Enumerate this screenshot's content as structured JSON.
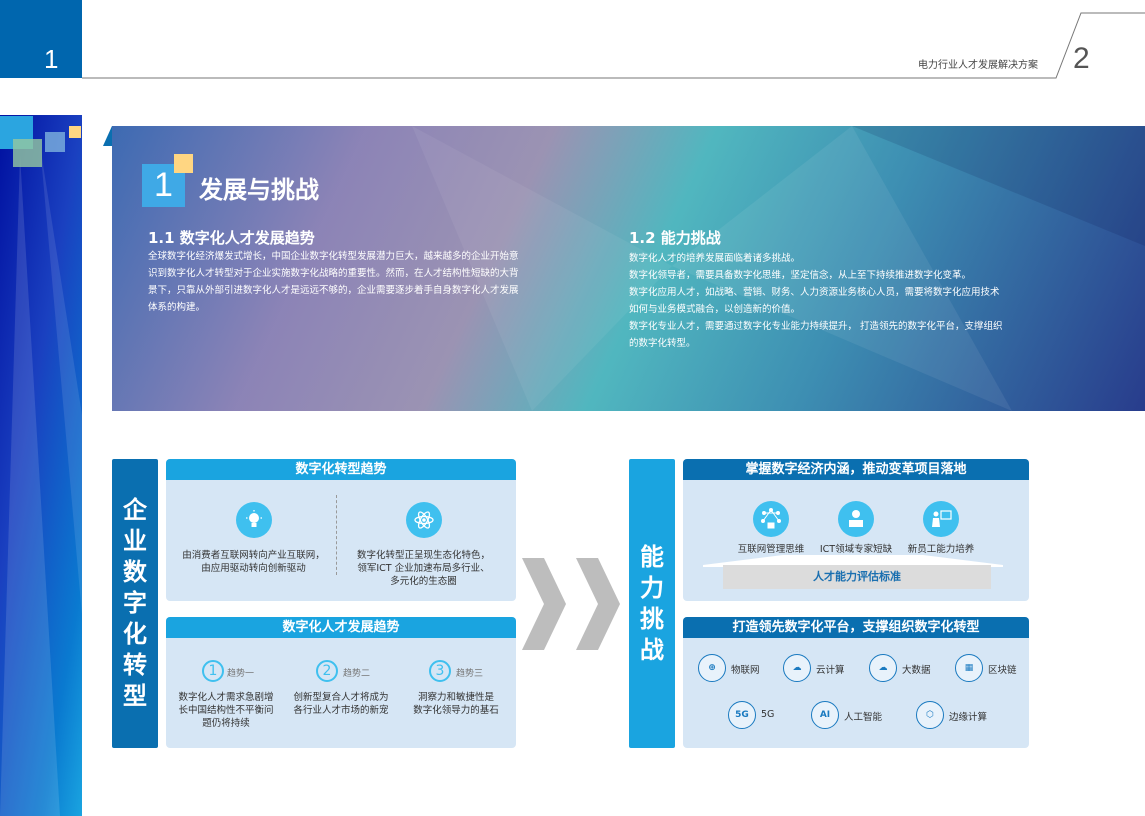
{
  "header": {
    "page_left": "1",
    "page_right": "2",
    "doc_title": "电力行业人才发展解决方案"
  },
  "banner": {
    "section_number": "1",
    "section_title": "发展与挑战",
    "left": {
      "title": "1.1  数字化人才发展趋势",
      "lines": [
        "全球数字化经济爆发式增长，中国企业数字化转型发展潜力巨大，越来越多的企业开始意",
        "识到数字化人才转型对于企业实施数字化战略的重要性。然而，在人才结构性短缺的大背",
        "景下，只靠从外部引进数字化人才是远远不够的，企业需要逐步着手自身数字化人才发展",
        "体系的构建。"
      ]
    },
    "right": {
      "title": "1.2  能力挑战",
      "lines": [
        "数字化人才的培养发展面临着诸多挑战。",
        "数字化领导者，需要具备数字化思维，坚定信念，从上至下持续推进数字化变革。",
        "数字化应用人才，如战略、营销、财务、人力资源业务核心人员，需要将数字化应用技术",
        "如何与业务模式融合，以创造新的价值。",
        "数字化专业人才，需要通过数字化专业能力持续提升， 打造领先的数字化平台，支撑组织",
        "的数字化转型。"
      ]
    }
  },
  "left_group": {
    "label": [
      "企",
      "业",
      "数",
      "字",
      "化",
      "转",
      "型"
    ],
    "panel1": {
      "title": "数字化转型趋势",
      "items": [
        [
          "由消费者互联网转向产业互联网，",
          "由应用驱动转向创新驱动"
        ],
        [
          "数字化转型正呈现生态化特色，",
          "领军ICT 企业加速布局多行业、",
          "多元化的生态圈"
        ]
      ]
    },
    "panel2": {
      "title": "数字化人才发展趋势",
      "items": [
        {
          "num": "1",
          "label": "趋势一",
          "lines": [
            "数字化人才需求急剧增",
            "长中国结构性不平衡问",
            "题仍将持续"
          ]
        },
        {
          "num": "2",
          "label": "趋势二",
          "lines": [
            "创新型复合人才将成为",
            "各行业人才市场的新宠"
          ]
        },
        {
          "num": "3",
          "label": "趋势三",
          "lines": [
            "洞察力和敏捷性是",
            "数字化领导力的基石"
          ]
        }
      ]
    }
  },
  "right_group": {
    "label": [
      "能",
      "力",
      "挑",
      "战"
    ],
    "panel3": {
      "title": "掌握数字经济内涵，推动变革项目落地",
      "items": [
        {
          "icon": "network-icon",
          "label": "互联网管理思维"
        },
        {
          "icon": "expert-icon",
          "label": "ICT领域专家短缺"
        },
        {
          "icon": "teacher-icon",
          "label": "新员工能力培养"
        }
      ],
      "base": "人才能力评估标准"
    },
    "panel4": {
      "title": "打造领先数字化平台，支撑组织数字化转型",
      "items": [
        {
          "icon": "iot-icon",
          "glyph": "⊕",
          "label": "物联网"
        },
        {
          "icon": "cloud-computing-icon",
          "glyph": "☁",
          "label": "云计算"
        },
        {
          "icon": "big-data-icon",
          "glyph": "☁",
          "label": "大数据"
        },
        {
          "icon": "blockchain-icon",
          "glyph": "▦",
          "label": "区块链"
        },
        {
          "icon": "5g-icon",
          "glyph": "5G",
          "label": "5G"
        },
        {
          "icon": "ai-icon",
          "glyph": "AI",
          "label": "人工智能"
        },
        {
          "icon": "edge-computing-icon",
          "glyph": "⬡",
          "label": "边缘计算"
        }
      ]
    }
  },
  "colors": {
    "dark_blue": "#0a6fb0",
    "light_blue": "#1aa4e0",
    "panel_bg": "#d6e6f5",
    "accent_yellow": "#ffd682"
  }
}
